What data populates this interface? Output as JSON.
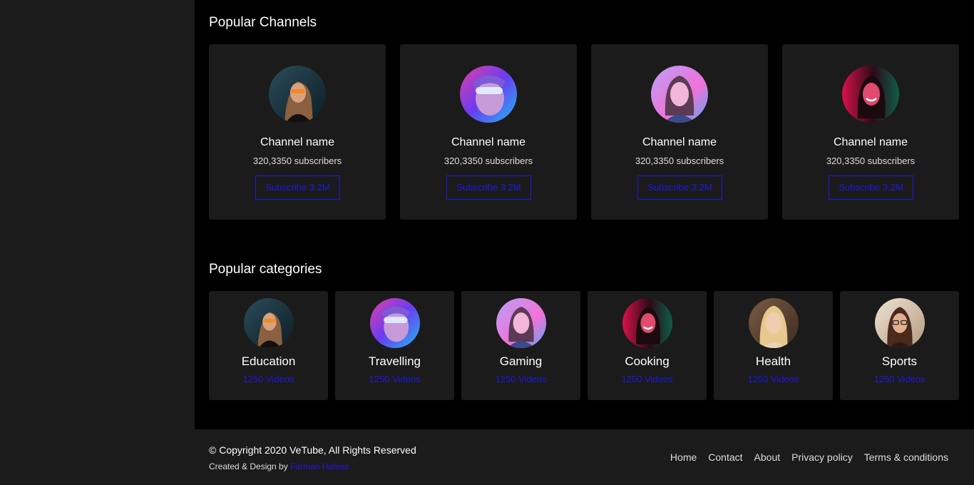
{
  "sections": {
    "channels_title": "Popular Channels",
    "categories_title": "Popular categories"
  },
  "channels": [
    {
      "name": "Channel name",
      "subscribers": "320,3350 subscribers",
      "button": "Subscribe 3.2M",
      "avatar": "woman-sunglasses-photo"
    },
    {
      "name": "Channel name",
      "subscribers": "320,3350 subscribers",
      "button": "Subscribe 3.2M",
      "avatar": "man-neon-glasses-photo"
    },
    {
      "name": "Channel name",
      "subscribers": "320,3350 subscribers",
      "button": "Subscribe 3.2M",
      "avatar": "woman-neon-portrait-photo"
    },
    {
      "name": "Channel name",
      "subscribers": "320,3350 subscribers",
      "button": "Subscribe 3.2M",
      "avatar": "woman-smiling-red-neon-photo"
    }
  ],
  "categories": [
    {
      "name": "Education",
      "count": "1250 Videos",
      "avatar": "woman-sunglasses-photo"
    },
    {
      "name": "Travelling",
      "count": "1250 Videos",
      "avatar": "man-neon-glasses-photo"
    },
    {
      "name": "Gaming",
      "count": "1250 Videos",
      "avatar": "woman-neon-portrait-photo"
    },
    {
      "name": "Cooking",
      "count": "1250 Videos",
      "avatar": "woman-smiling-red-neon-photo"
    },
    {
      "name": "Health",
      "count": "1250 Videos",
      "avatar": "blonde-woman-photo"
    },
    {
      "name": "Sports",
      "count": "1250 Videos",
      "avatar": "woman-glasses-photo"
    }
  ],
  "footer": {
    "copyright": "© Copyright 2020 VeTube, All Rights Reserved",
    "credit_prefix": "Created & Design by",
    "credit_name": "Farman Hafeez",
    "nav": [
      "Home",
      "Contact",
      "About",
      "Privacy policy",
      "Terms & conditions"
    ]
  },
  "colors": {
    "background": "#000000",
    "panel": "#1b1b1b",
    "accent": "#1a1ae6"
  }
}
